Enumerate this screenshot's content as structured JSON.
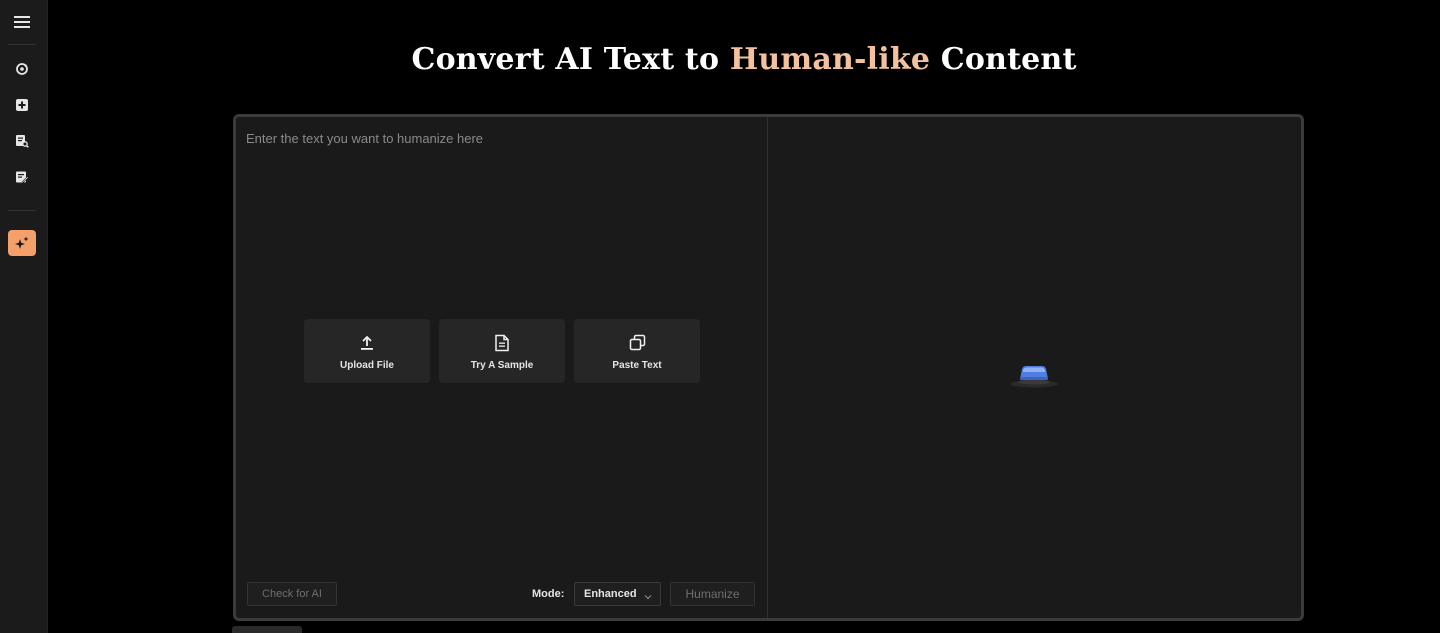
{
  "sidebar": {
    "items": [
      {
        "icon": "menu-icon"
      },
      {
        "icon": "refresh-icon"
      },
      {
        "icon": "plus-square-icon"
      },
      {
        "icon": "doc-search-icon"
      },
      {
        "icon": "edit-doc-icon"
      },
      {
        "icon": "sparkle-icon",
        "active": true
      }
    ],
    "active_color": "#f3a06a"
  },
  "header": {
    "title_prefix": "Convert AI Text to ",
    "title_accent": "Human-like",
    "title_suffix": " Content",
    "accent_color": "#f3c19e"
  },
  "editor": {
    "placeholder": "Enter the text you want to humanize here",
    "value": ""
  },
  "quick_actions": [
    {
      "label": "Upload File",
      "icon": "upload-icon"
    },
    {
      "label": "Try A Sample",
      "icon": "document-icon"
    },
    {
      "label": "Paste Text",
      "icon": "copy-icon"
    }
  ],
  "footer": {
    "check_label": "Check for AI",
    "mode_label": "Mode:",
    "mode_value": "Enhanced",
    "humanize_label": "Humanize"
  }
}
